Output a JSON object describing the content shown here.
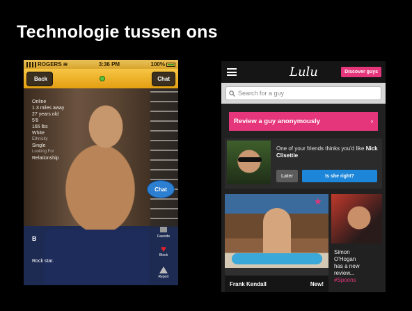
{
  "slide": {
    "title": "Technologie tussen ons"
  },
  "left_phone": {
    "status": {
      "carrier": "ROGERS",
      "time": "3:36 PM",
      "battery": "100%"
    },
    "nav": {
      "back_label": "Back",
      "chat_label": "Chat"
    },
    "profile_stats": [
      "Online",
      "1.3 miles away",
      "27 years old",
      "5'8",
      "165 lbs",
      "White"
    ],
    "profile_muted_1": "Ethnicity",
    "profile_relationship_status": "Single",
    "profile_muted_2": "Looking For",
    "profile_looking_for": "Relationship",
    "chat_bubble_label": "Chat",
    "side_actions": {
      "favorite": "Favorite",
      "block": "Block",
      "report": "Report"
    },
    "profile_name": "B",
    "profile_tagline": "Rock star."
  },
  "right_phone": {
    "logo": "Lulu",
    "discover_label": "Discover guys",
    "search_placeholder": "Search for a guy",
    "review_label": "Review a guy anonymously",
    "card_text": "One of your friends thinks you'd like",
    "card_name": "Nick Clisettie",
    "later_label": "Later",
    "is_right_label": "Is she right?",
    "big_tile_name": "Frank Kendall",
    "big_tile_badge": "New!",
    "small_tile_lines": [
      "Simon",
      "O'Hogan",
      "has a new",
      "review..."
    ],
    "small_tile_hashtag": "#Spoons",
    "colors": {
      "accent": "#e5367b",
      "blue": "#1e86d8"
    }
  }
}
